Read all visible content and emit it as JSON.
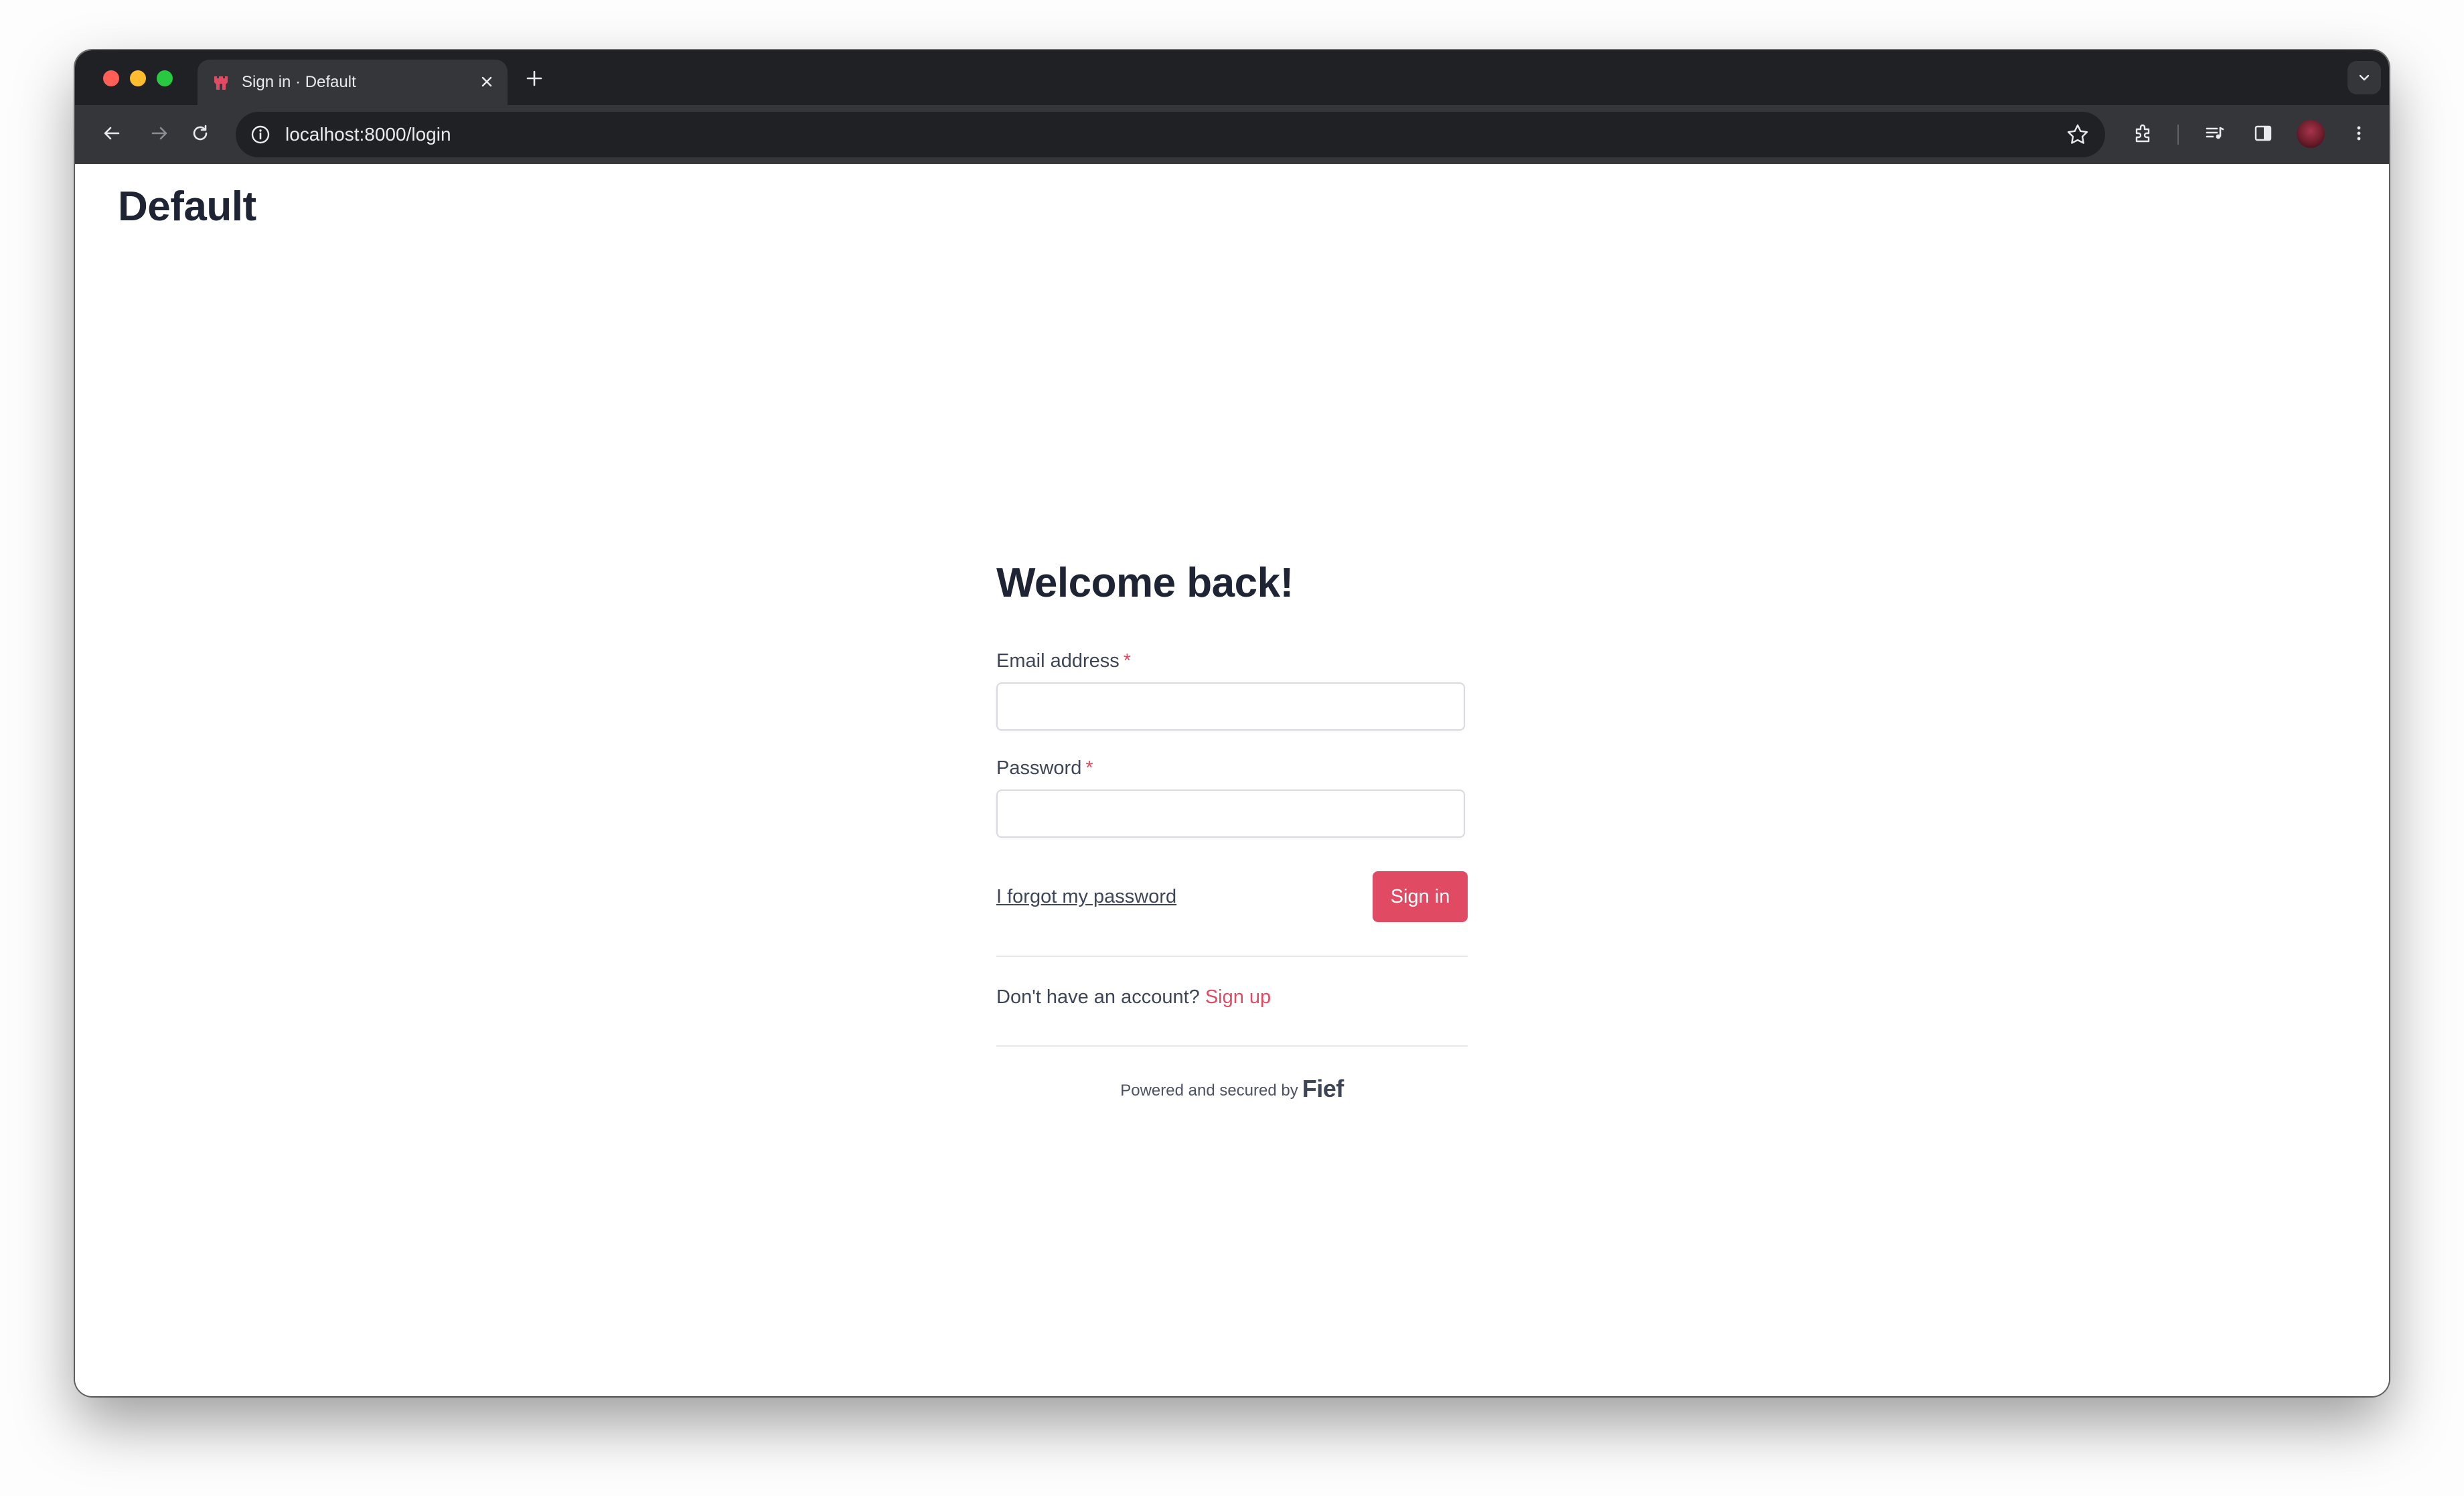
{
  "browser": {
    "tab": {
      "title": "Sign in · Default",
      "favicon": "fief-castle-icon"
    },
    "address_bar": {
      "url": "localhost:8000/login"
    },
    "colors": {
      "chrome_dark": "#202124",
      "toolbar": "#35363a"
    }
  },
  "page": {
    "tenant_name": "Default",
    "heading": "Welcome back!",
    "email": {
      "label": "Email address",
      "required_marker": "*",
      "value": ""
    },
    "password": {
      "label": "Password",
      "required_marker": "*",
      "value": ""
    },
    "forgot_link": "I forgot my password",
    "submit_label": "Sign in",
    "signup_prompt": "Don't have an account?",
    "signup_link": "Sign up",
    "footer_text": "Powered and secured by",
    "footer_brand": "Fief",
    "colors": {
      "accent": "#e04b63",
      "heading": "#1e2433"
    }
  }
}
